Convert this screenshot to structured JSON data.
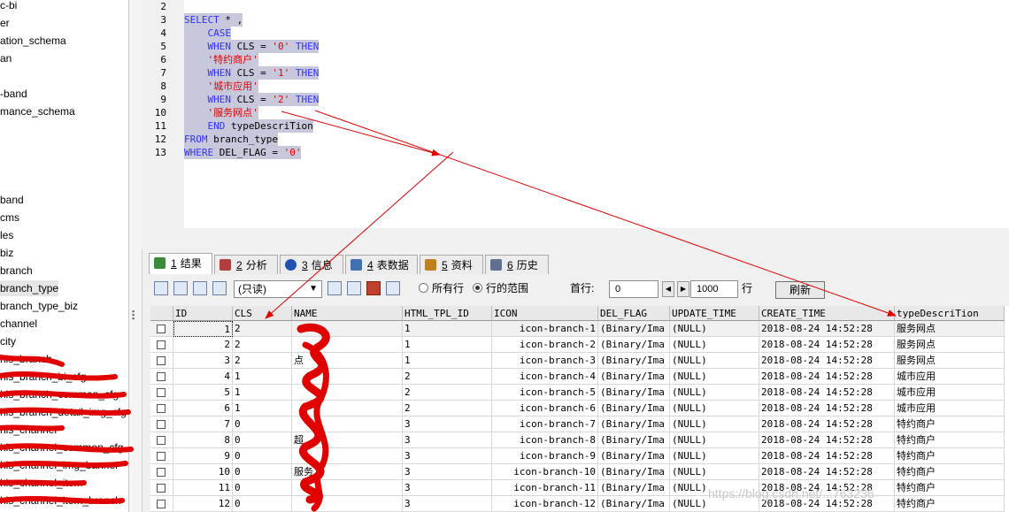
{
  "schema_tree": {
    "items": [
      "c-bi",
      "er",
      "ation_schema",
      "an",
      "",
      "-band",
      "mance_schema",
      "",
      "",
      "",
      "",
      "band",
      "cms",
      "les",
      "biz",
      "branch",
      "branch_type",
      "branch_type_biz",
      "channel",
      "city",
      "his_branch",
      "his_branch_bi_cfg",
      "his_branch_common_cfg",
      "his_branch_detail_img_cfg",
      "his_channel",
      "his_channel_common_cfg",
      "his_channel_img_banner",
      "his_channel_item",
      "his_channel_item_branch"
    ],
    "selected": "branch_type"
  },
  "editor": {
    "line_numbers": [
      "2",
      "3",
      "4",
      "5",
      "6",
      "7",
      "8",
      "9",
      "10",
      "11",
      "12",
      "13"
    ],
    "lines": [
      [],
      [
        {
          "t": "kw",
          "v": "SELECT"
        },
        {
          "t": "pl",
          "v": " * ,"
        }
      ],
      [
        {
          "t": "pl",
          "v": "    "
        },
        {
          "t": "kw",
          "v": "CASE"
        }
      ],
      [
        {
          "t": "pl",
          "v": "    "
        },
        {
          "t": "kw",
          "v": "WHEN"
        },
        {
          "t": "pl",
          "v": " CLS = "
        },
        {
          "t": "st",
          "v": "'0'"
        },
        {
          "t": "pl",
          "v": " "
        },
        {
          "t": "kw",
          "v": "THEN"
        }
      ],
      [
        {
          "t": "pl",
          "v": "    "
        },
        {
          "t": "st",
          "v": "'特约商户'"
        }
      ],
      [
        {
          "t": "pl",
          "v": "    "
        },
        {
          "t": "kw",
          "v": "WHEN"
        },
        {
          "t": "pl",
          "v": " CLS = "
        },
        {
          "t": "st",
          "v": "'1'"
        },
        {
          "t": "pl",
          "v": " "
        },
        {
          "t": "kw",
          "v": "THEN"
        }
      ],
      [
        {
          "t": "pl",
          "v": "    "
        },
        {
          "t": "st",
          "v": "'城市应用'"
        }
      ],
      [
        {
          "t": "pl",
          "v": "    "
        },
        {
          "t": "kw",
          "v": "WHEN"
        },
        {
          "t": "pl",
          "v": " CLS = "
        },
        {
          "t": "st",
          "v": "'2'"
        },
        {
          "t": "pl",
          "v": " "
        },
        {
          "t": "kw",
          "v": "THEN"
        }
      ],
      [
        {
          "t": "pl",
          "v": "    "
        },
        {
          "t": "st",
          "v": "'服务网点'"
        }
      ],
      [
        {
          "t": "pl",
          "v": "    "
        },
        {
          "t": "kw",
          "v": "END"
        },
        {
          "t": "pl",
          "v": " typeDescriTion"
        }
      ],
      [
        {
          "t": "kw",
          "v": "FROM"
        },
        {
          "t": "pl",
          "v": " branch_type"
        }
      ],
      [
        {
          "t": "kw",
          "v": "WHERE"
        },
        {
          "t": "pl",
          "v": " DEL_FLAG = "
        },
        {
          "t": "st",
          "v": "'0'"
        }
      ]
    ]
  },
  "tabs": [
    {
      "num": "1",
      "label": "结果",
      "icon": "result-grid-icon",
      "active": true
    },
    {
      "num": "2",
      "label": "分析",
      "icon": "profile-icon",
      "active": false
    },
    {
      "num": "3",
      "label": "信息",
      "icon": "info-icon",
      "active": false
    },
    {
      "num": "4",
      "label": "表数据",
      "icon": "table-data-icon",
      "active": false
    },
    {
      "num": "5",
      "label": "资料",
      "icon": "objects-icon",
      "active": false
    },
    {
      "num": "6",
      "label": "历史",
      "icon": "history-icon",
      "active": false
    }
  ],
  "toolbar": {
    "mode_value": "(只读)",
    "all_rows_label": "所有行",
    "row_range_label": "行的范围",
    "first_row_label": "首行:",
    "first_row_value": "0",
    "row_count_value": "1000",
    "rows_label": "行",
    "refresh_label": "刷新"
  },
  "grid": {
    "columns": [
      "ID",
      "CLS",
      "NAME",
      "HTML_TPL_ID",
      "ICON",
      "DEL_FLAG",
      "UPDATE_TIME",
      "CREATE_TIME",
      "typeDescriTion"
    ],
    "rows": [
      [
        "1",
        "2",
        "",
        "1",
        "icon-branch-1",
        "(Binary/Ima",
        "(NULL)",
        "2018-08-24 14:52:28",
        "服务网点"
      ],
      [
        "2",
        "2",
        "",
        "1",
        "icon-branch-2",
        "(Binary/Ima",
        "(NULL)",
        "2018-08-24 14:52:28",
        "服务网点"
      ],
      [
        "3",
        "2",
        "点",
        "1",
        "icon-branch-3",
        "(Binary/Ima",
        "(NULL)",
        "2018-08-24 14:52:28",
        "服务网点"
      ],
      [
        "4",
        "1",
        "",
        "2",
        "icon-branch-4",
        "(Binary/Ima",
        "(NULL)",
        "2018-08-24 14:52:28",
        "城市应用"
      ],
      [
        "5",
        "1",
        "",
        "2",
        "icon-branch-5",
        "(Binary/Ima",
        "(NULL)",
        "2018-08-24 14:52:28",
        "城市应用"
      ],
      [
        "6",
        "1",
        "",
        "2",
        "icon-branch-6",
        "(Binary/Ima",
        "(NULL)",
        "2018-08-24 14:52:28",
        "城市应用"
      ],
      [
        "7",
        "0",
        "",
        "3",
        "icon-branch-7",
        "(Binary/Ima",
        "(NULL)",
        "2018-08-24 14:52:28",
        "特约商户"
      ],
      [
        "8",
        "0",
        "超",
        "3",
        "icon-branch-8",
        "(Binary/Ima",
        "(NULL)",
        "2018-08-24 14:52:28",
        "特约商户"
      ],
      [
        "9",
        "0",
        "",
        "3",
        "icon-branch-9",
        "(Binary/Ima",
        "(NULL)",
        "2018-08-24 14:52:28",
        "特约商户"
      ],
      [
        "10",
        "0",
        "服务",
        "3",
        "icon-branch-10",
        "(Binary/Ima",
        "(NULL)",
        "2018-08-24 14:52:28",
        "特约商户"
      ],
      [
        "11",
        "0",
        "",
        "3",
        "icon-branch-11",
        "(Binary/Ima",
        "(NULL)",
        "2018-08-24 14:52:28",
        "特约商户"
      ],
      [
        "12",
        "0",
        "",
        "3",
        "icon-branch-12",
        "(Binary/Ima",
        "(NULL)",
        "2018-08-24 14:52:28",
        "特约商户"
      ]
    ]
  },
  "watermark": "https://blog.csdn.net/...763236",
  "colors": {
    "keyword": "#3030ff",
    "string": "#e00000",
    "annotation": "#e00000"
  }
}
